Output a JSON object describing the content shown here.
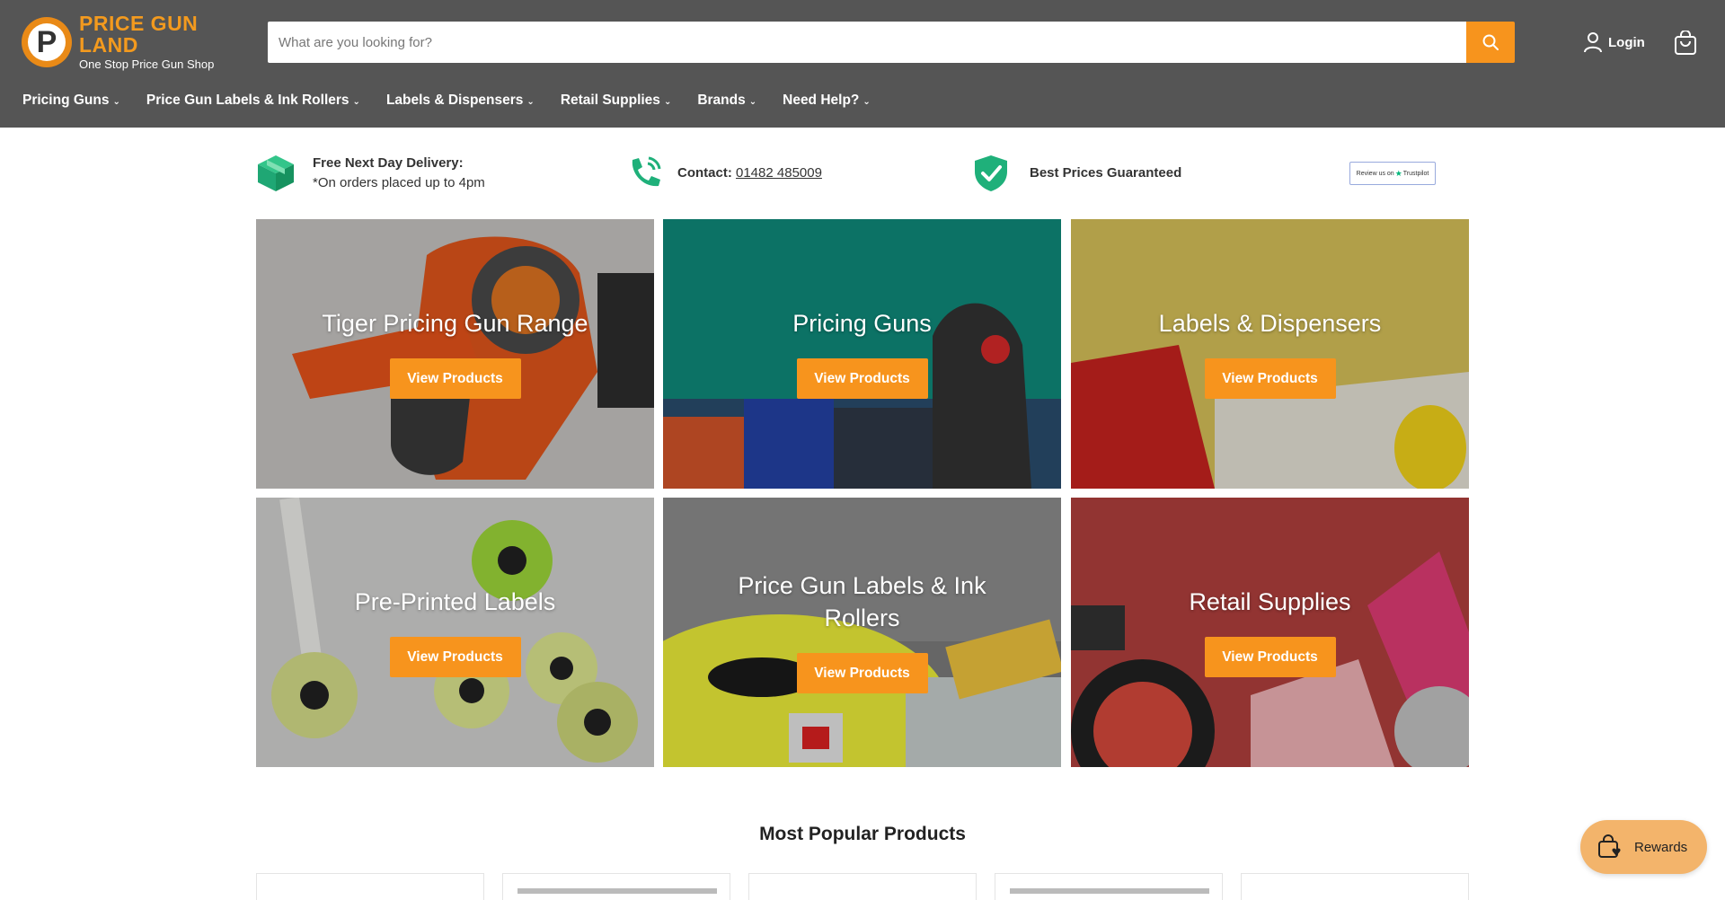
{
  "header": {
    "logo_title": "PRICE GUN LAND",
    "logo_subtitle": "One Stop Price Gun Shop",
    "logo_letter": "P",
    "search_placeholder": "What are you looking for?",
    "login_label": "Login",
    "accent_color": "#f7941d",
    "background_color": "#555555"
  },
  "nav": {
    "items": [
      {
        "label": "Pricing Guns"
      },
      {
        "label": "Price Gun Labels & Ink Rollers"
      },
      {
        "label": "Labels & Dispensers"
      },
      {
        "label": "Retail Supplies"
      },
      {
        "label": "Brands"
      },
      {
        "label": "Need Help?"
      }
    ]
  },
  "usp": {
    "delivery_title": "Free Next Day Delivery:",
    "delivery_sub": "*On orders placed up to 4pm",
    "contact_label": "Contact:",
    "contact_phone": "01482 485009",
    "best_prices": "Best Prices Guaranteed",
    "trustpilot_label": "Review us on",
    "trustpilot_brand": "Trustpilot",
    "icon_color": "#1fb07a"
  },
  "tiles": [
    {
      "title": "Tiger Pricing Gun Range",
      "button": "View Products"
    },
    {
      "title": "Pricing Guns",
      "button": "View Products"
    },
    {
      "title": "Labels & Dispensers",
      "button": "View Products"
    },
    {
      "title": "Pre-Printed Labels",
      "button": "View Products"
    },
    {
      "title": "Price Gun Labels & Ink Rollers",
      "button": "View Products"
    },
    {
      "title": "Retail Supplies",
      "button": "View Products"
    }
  ],
  "popular": {
    "heading": "Most Popular Products"
  },
  "rewards": {
    "label": "Rewards"
  }
}
